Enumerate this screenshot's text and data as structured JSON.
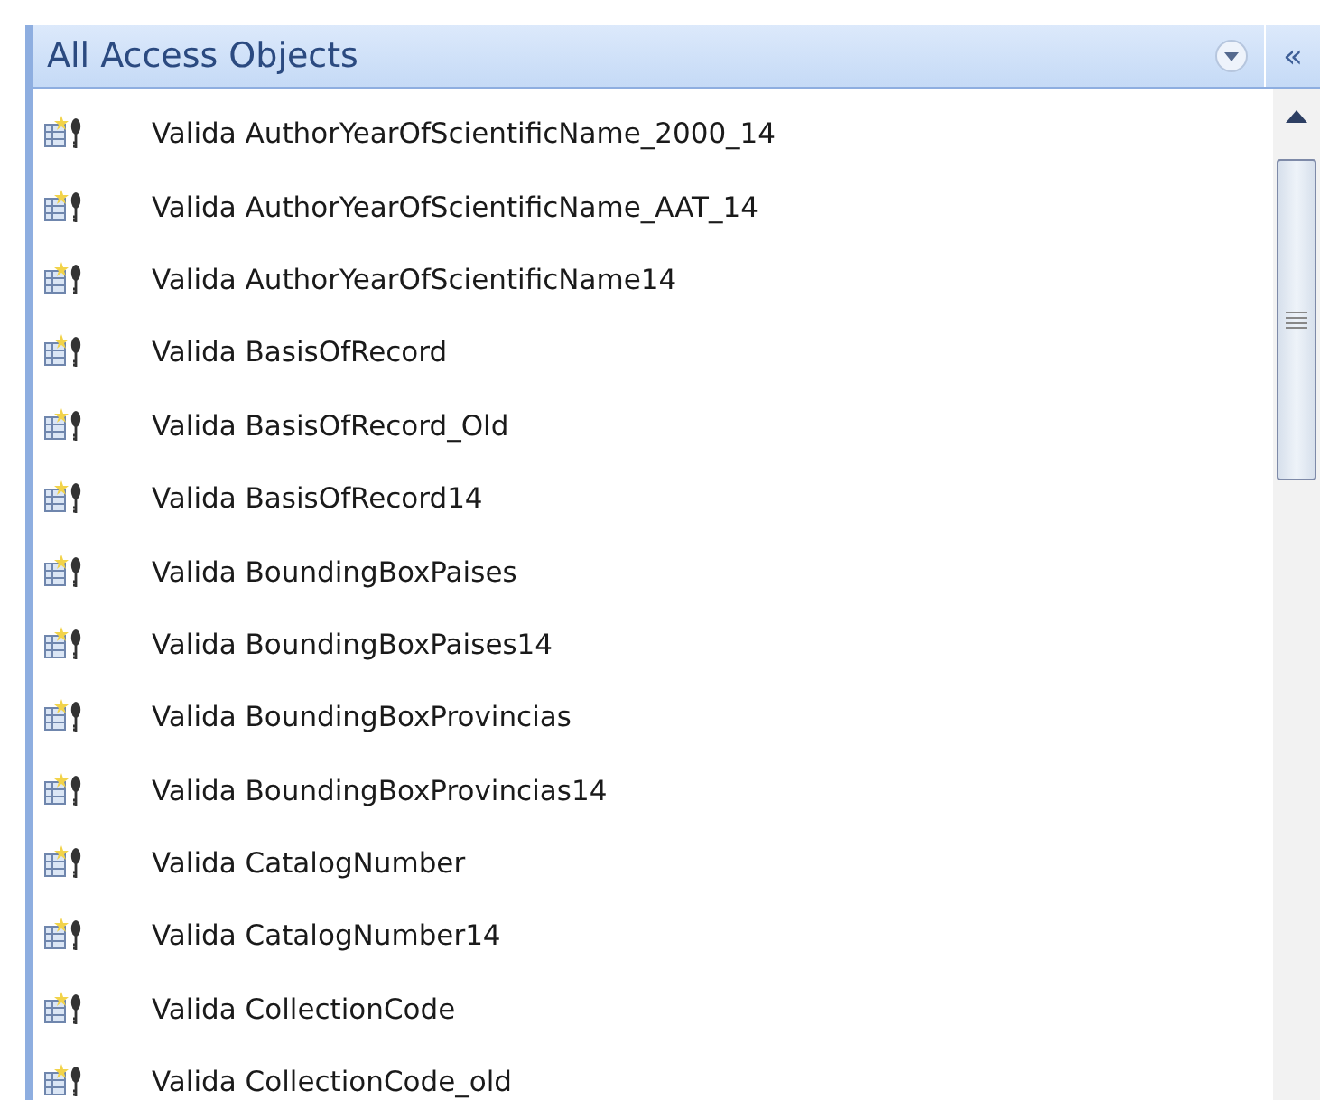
{
  "pane": {
    "title": "All Access Objects",
    "collapse_glyph": "«"
  },
  "items": [
    {
      "label": "Valida AuthorYearOfScientificName_2000_14"
    },
    {
      "label": "Valida AuthorYearOfScientificName_AAT_14"
    },
    {
      "label": "Valida AuthorYearOfScientificName14"
    },
    {
      "label": "Valida BasisOfRecord"
    },
    {
      "label": "Valida BasisOfRecord_Old"
    },
    {
      "label": "Valida BasisOfRecord14"
    },
    {
      "label": "Valida BoundingBoxPaises"
    },
    {
      "label": "Valida BoundingBoxPaises14"
    },
    {
      "label": "Valida BoundingBoxProvincias"
    },
    {
      "label": "Valida BoundingBoxProvincias14"
    },
    {
      "label": "Valida CatalogNumber"
    },
    {
      "label": "Valida CatalogNumber14"
    },
    {
      "label": "Valida CollectionCode"
    },
    {
      "label": "Valida CollectionCode_old"
    }
  ]
}
